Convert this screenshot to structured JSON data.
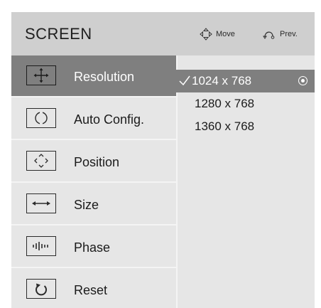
{
  "header": {
    "title": "SCREEN",
    "hints": [
      {
        "icon": "move-icon",
        "label": "Move"
      },
      {
        "icon": "prev-icon",
        "label": "Prev."
      }
    ]
  },
  "menu": {
    "items": [
      {
        "label": "Resolution",
        "icon": "resolution-icon",
        "active": true
      },
      {
        "label": "Auto Config.",
        "icon": "auto-config-icon",
        "active": false
      },
      {
        "label": "Position",
        "icon": "position-icon",
        "active": false
      },
      {
        "label": "Size",
        "icon": "size-icon",
        "active": false
      },
      {
        "label": "Phase",
        "icon": "phase-icon",
        "active": false
      },
      {
        "label": "Reset",
        "icon": "reset-icon",
        "active": false
      }
    ]
  },
  "submenu": {
    "options": [
      {
        "label": "1024 x 768",
        "selected": true
      },
      {
        "label": "1280 x 768",
        "selected": false
      },
      {
        "label": "1360 x 768",
        "selected": false
      }
    ]
  },
  "colors": {
    "panel_bg": "#e6e6e6",
    "header_bg": "#cfcfcf",
    "highlight": "#7f7f7f",
    "divider": "#f4f4f4"
  }
}
